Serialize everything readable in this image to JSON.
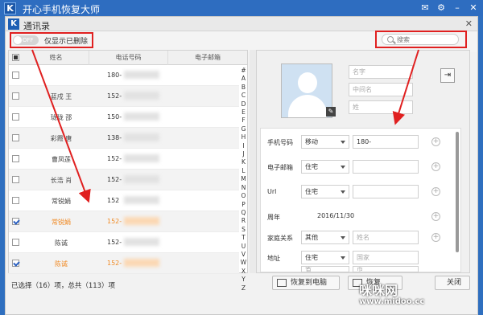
{
  "app": {
    "title": "开心手机恢复大师",
    "logo_letter": "K",
    "controls": [
      "chat-icon",
      "settings-icon",
      "minimize-icon",
      "close-icon"
    ]
  },
  "dialog": {
    "title": "通讯录",
    "logo_letter": "K"
  },
  "toolbar": {
    "toggle_state": "OFF",
    "toggle_label": "仅显示已删除",
    "search_placeholder": "搜索"
  },
  "list": {
    "columns": [
      "姓名",
      "电话号码",
      "电子邮箱"
    ],
    "rows": [
      {
        "name": "",
        "phone": "180-",
        "checked": false,
        "deleted": false
      },
      {
        "name": "蓝戍 王",
        "phone": "152-",
        "checked": false,
        "deleted": false
      },
      {
        "name": "珑珑 邵",
        "phone": "150-",
        "checked": false,
        "deleted": false
      },
      {
        "name": "彩霞 唐",
        "phone": "138-",
        "checked": false,
        "deleted": false
      },
      {
        "name": "曹凤莲",
        "phone": "152-",
        "checked": false,
        "deleted": false
      },
      {
        "name": "长浩 肖",
        "phone": "152-",
        "checked": false,
        "deleted": false
      },
      {
        "name": "常锐娟",
        "phone": "152",
        "checked": false,
        "deleted": false
      },
      {
        "name": "常锐娟",
        "phone": "152-",
        "checked": true,
        "deleted": true
      },
      {
        "name": "陈诚",
        "phone": "152-",
        "checked": false,
        "deleted": false
      },
      {
        "name": "陈诚",
        "phone": "152-",
        "checked": true,
        "deleted": true
      }
    ],
    "alphabet": [
      "#",
      "A",
      "B",
      "C",
      "D",
      "E",
      "F",
      "G",
      "H",
      "I",
      "J",
      "K",
      "L",
      "M",
      "N",
      "O",
      "P",
      "Q",
      "R",
      "S",
      "T",
      "U",
      "V",
      "W",
      "X",
      "Y",
      "Z"
    ]
  },
  "detail": {
    "name_fields": [
      "名字",
      "中间名",
      "姓"
    ],
    "phone": {
      "label": "手机号码",
      "type": "移动",
      "value": "180-"
    },
    "email": {
      "label": "电子邮箱",
      "type": "住宅"
    },
    "url": {
      "label": "Url",
      "type": "住宅"
    },
    "anniversary": {
      "label": "周年",
      "value": "2016/11/30"
    },
    "family": {
      "label": "家庭关系",
      "type": "其他",
      "placeholder": "姓名"
    },
    "address": {
      "label": "地址",
      "type": "住宅",
      "country_placeholder": "国家",
      "province_placeholder": "省",
      "city_placeholder": "市"
    }
  },
  "footer": {
    "status": "已选择（16）项，总共（113）项",
    "restore_to_pc": "恢复到电脑",
    "restore_to_device": "恢复",
    "close": "关闭"
  },
  "watermark": {
    "line1": "咪咪网",
    "line2": "www.midoo.cc"
  },
  "colors": {
    "titlebar": "#2e6dc0",
    "deleted": "#f08a24",
    "annotation": "#e02020"
  }
}
